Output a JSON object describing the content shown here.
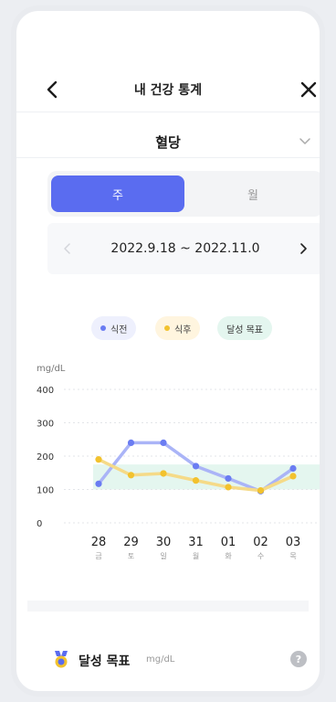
{
  "header": {
    "title": "내 건강 통계"
  },
  "section": {
    "title": "혈당"
  },
  "tabs": [
    {
      "label": "주",
      "selected": true
    },
    {
      "label": "월",
      "selected": false
    }
  ],
  "date_range": "2022.9.18 ~ 2022.11.0",
  "legend": {
    "before": "식전",
    "after": "식후",
    "goal": "달성 목표"
  },
  "colors": {
    "before": "#6a7cf2",
    "after": "#f2c22e",
    "goal_band": "#e4f6ef",
    "accent": "#5a6cf0"
  },
  "chart_data": {
    "type": "line",
    "ylabel": "mg/dL",
    "ylim": [
      0,
      400
    ],
    "yticks": [
      0,
      100,
      200,
      300,
      400
    ],
    "x": [
      "28",
      "29",
      "30",
      "31",
      "01",
      "02",
      "03"
    ],
    "x_weekday": [
      "금",
      "토",
      "일",
      "월",
      "화",
      "수",
      "목"
    ],
    "goal_range": [
      100,
      175
    ],
    "series": [
      {
        "name": "식전",
        "values": [
          117,
          240,
          240,
          170,
          133,
          95,
          163
        ]
      },
      {
        "name": "식후",
        "values": [
          190,
          143,
          148,
          127,
          107,
          97,
          140
        ]
      }
    ]
  },
  "goal_section": {
    "label": "달성 목표",
    "unit": "mg/dL",
    "help": "?"
  }
}
